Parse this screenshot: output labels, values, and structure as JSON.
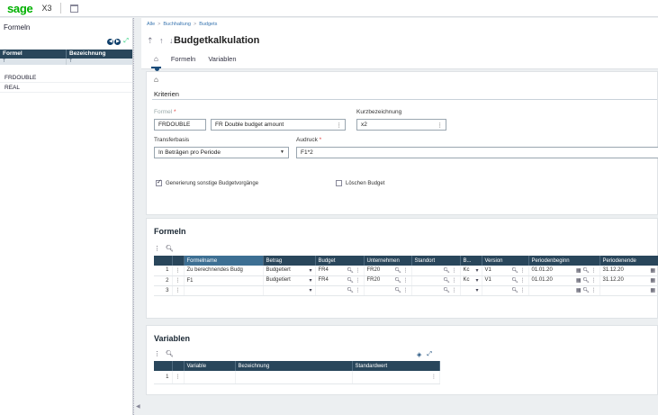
{
  "topbar": {
    "logo": "sage",
    "product": "X3"
  },
  "left": {
    "title": "Formeln",
    "col1": "Formel",
    "col2": "Bezeichnung",
    "filter_icon": "T",
    "rows": [
      "FRDOUBLE",
      "REAL"
    ]
  },
  "breadcrumb": [
    "Alle",
    "Buchhaltung",
    "Budgets"
  ],
  "page": {
    "title": "Budgetkalkulation",
    "nav": "⇡ ↑ ↓ ⇣"
  },
  "tabs": {
    "formeln": "Formeln",
    "variablen": "Variablen"
  },
  "kriterien": {
    "title": "Kriterien",
    "formel_label": "Formel",
    "formel_value": "FRDOUBLE",
    "bezeichnung_value": "FR Double budget amount",
    "kurz_label": "Kurzbezeichnung",
    "kurz_value": "x2",
    "transfer_label": "Transferbasis",
    "transfer_value": "In Beträgen pro Periode",
    "ausdruck_label": "Audruck",
    "ausdruck_value": "F1*2",
    "chk1_label": "Generierung sonstige Budgetvorgänge",
    "chk2_label": "Löschen Budget",
    "required_mark": "*"
  },
  "formeln": {
    "title": "Formeln",
    "headers": [
      "Formelname",
      "Betrag",
      "Budget",
      "Unternehmen",
      "Standort",
      "B...",
      "Version",
      "Periodenbeginn",
      "Periodenende"
    ],
    "rows": [
      {
        "n": "1",
        "name": "Zu berechnendes Budg",
        "betrag": "Budgetiert",
        "budget": "FR4",
        "unt": "FR20",
        "b": "Kc",
        "version": "V1",
        "beginn": "01.01.20",
        "ende": "31.12.20"
      },
      {
        "n": "2",
        "name": "F1",
        "betrag": "Budgetiert",
        "budget": "FR4",
        "unt": "FR20",
        "b": "Kc",
        "version": "V1",
        "beginn": "01.01.20",
        "ende": "31.12.20"
      },
      {
        "n": "3",
        "name": "",
        "betrag": "",
        "budget": "",
        "unt": "",
        "b": "",
        "version": "",
        "beginn": "",
        "ende": ""
      }
    ]
  },
  "variablen": {
    "title": "Variablen",
    "headers": [
      "Variable",
      "Bezeichnung",
      "Standardwert"
    ],
    "row_num": "1"
  },
  "colors": {
    "header": "#29465b",
    "logo": "#00b000",
    "accent": "#1a4c7a"
  }
}
